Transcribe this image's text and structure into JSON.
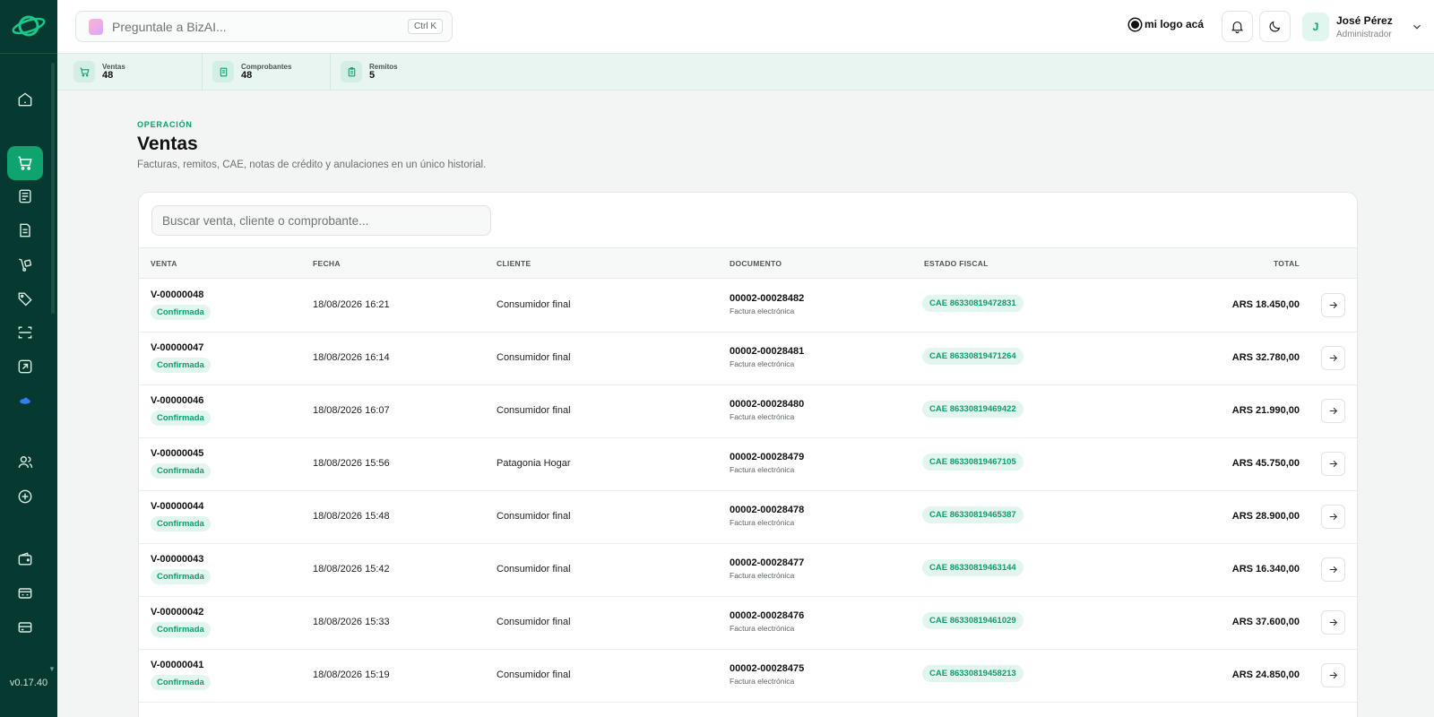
{
  "app": {
    "version": "v0.17.40",
    "brand_text": "mi logo acá",
    "colors": {
      "sidebar": "#06392f",
      "accent": "#0fa36f",
      "accent_text": "#0f9d6c",
      "badge_bg": "#e2f5ee"
    }
  },
  "search_ai": {
    "placeholder": "Preguntale a BizAI...",
    "shortcut": "Ctrl K"
  },
  "user": {
    "initial": "J",
    "name": "José Pérez",
    "role": "Administrador"
  },
  "sidebar": {
    "items": [
      {
        "name": "home",
        "icon": "home-icon"
      },
      {
        "name": "ventas",
        "icon": "cart-icon",
        "active": true
      },
      {
        "name": "comprobantes",
        "icon": "list-doc-icon"
      },
      {
        "name": "remitos",
        "icon": "document-icon"
      },
      {
        "name": "envios",
        "icon": "dolly-icon"
      },
      {
        "name": "productos",
        "icon": "tags-icon"
      },
      {
        "name": "escaner",
        "icon": "scan-icon"
      },
      {
        "name": "reportes",
        "icon": "chart-box-icon"
      },
      {
        "name": "nube",
        "icon": "cloud-icon"
      },
      {
        "name": "clientes",
        "icon": "users-icon"
      },
      {
        "name": "explorar",
        "icon": "compass-icon"
      },
      {
        "name": "billetera",
        "icon": "wallet-icon"
      },
      {
        "name": "caja",
        "icon": "register-icon"
      },
      {
        "name": "tarjetas",
        "icon": "credit-card-icon"
      }
    ]
  },
  "stats": [
    {
      "label": "Ventas",
      "value": "48",
      "icon": "cart-icon"
    },
    {
      "label": "Comprobantes",
      "value": "48",
      "icon": "receipt-icon"
    },
    {
      "label": "Remitos",
      "value": "5",
      "icon": "clipboard-icon"
    }
  ],
  "page": {
    "eyebrow": "OPERACIÓN",
    "title": "Ventas",
    "subtitle": "Facturas, remitos, CAE, notas de crédito y anulaciones en un único historial."
  },
  "table": {
    "search_placeholder": "Buscar venta, cliente o comprobante...",
    "columns": {
      "venta": "VENTA",
      "fecha": "FECHA",
      "cliente": "CLIENTE",
      "documento": "DOCUMENTO",
      "estado": "ESTADO FISCAL",
      "total": "TOTAL"
    },
    "rows": [
      {
        "id": "V-00000048",
        "status": "Confirmada",
        "date": "18/08/2026 16:21",
        "client": "Consumidor final",
        "doc": "00002-00028482",
        "doc_type": "Factura electrónica",
        "cae": "CAE 86330819472831",
        "total": "ARS 18.450,00"
      },
      {
        "id": "V-00000047",
        "status": "Confirmada",
        "date": "18/08/2026 16:14",
        "client": "Consumidor final",
        "doc": "00002-00028481",
        "doc_type": "Factura electrónica",
        "cae": "CAE 86330819471264",
        "total": "ARS 32.780,00"
      },
      {
        "id": "V-00000046",
        "status": "Confirmada",
        "date": "18/08/2026 16:07",
        "client": "Consumidor final",
        "doc": "00002-00028480",
        "doc_type": "Factura electrónica",
        "cae": "CAE 86330819469422",
        "total": "ARS 21.990,00"
      },
      {
        "id": "V-00000045",
        "status": "Confirmada",
        "date": "18/08/2026 15:56",
        "client": "Patagonia Hogar",
        "doc": "00002-00028479",
        "doc_type": "Factura electrónica",
        "cae": "CAE 86330819467105",
        "total": "ARS 45.750,00"
      },
      {
        "id": "V-00000044",
        "status": "Confirmada",
        "date": "18/08/2026 15:48",
        "client": "Consumidor final",
        "doc": "00002-00028478",
        "doc_type": "Factura electrónica",
        "cae": "CAE 86330819465387",
        "total": "ARS 28.900,00"
      },
      {
        "id": "V-00000043",
        "status": "Confirmada",
        "date": "18/08/2026 15:42",
        "client": "Consumidor final",
        "doc": "00002-00028477",
        "doc_type": "Factura electrónica",
        "cae": "CAE 86330819463144",
        "total": "ARS 16.340,00"
      },
      {
        "id": "V-00000042",
        "status": "Confirmada",
        "date": "18/08/2026 15:33",
        "client": "Consumidor final",
        "doc": "00002-00028476",
        "doc_type": "Factura electrónica",
        "cae": "CAE 86330819461029",
        "total": "ARS 37.600,00"
      },
      {
        "id": "V-00000041",
        "status": "Confirmada",
        "date": "18/08/2026 15:19",
        "client": "Consumidor final",
        "doc": "00002-00028475",
        "doc_type": "Factura electrónica",
        "cae": "CAE 86330819458213",
        "total": "ARS 24.850,00"
      }
    ]
  }
}
